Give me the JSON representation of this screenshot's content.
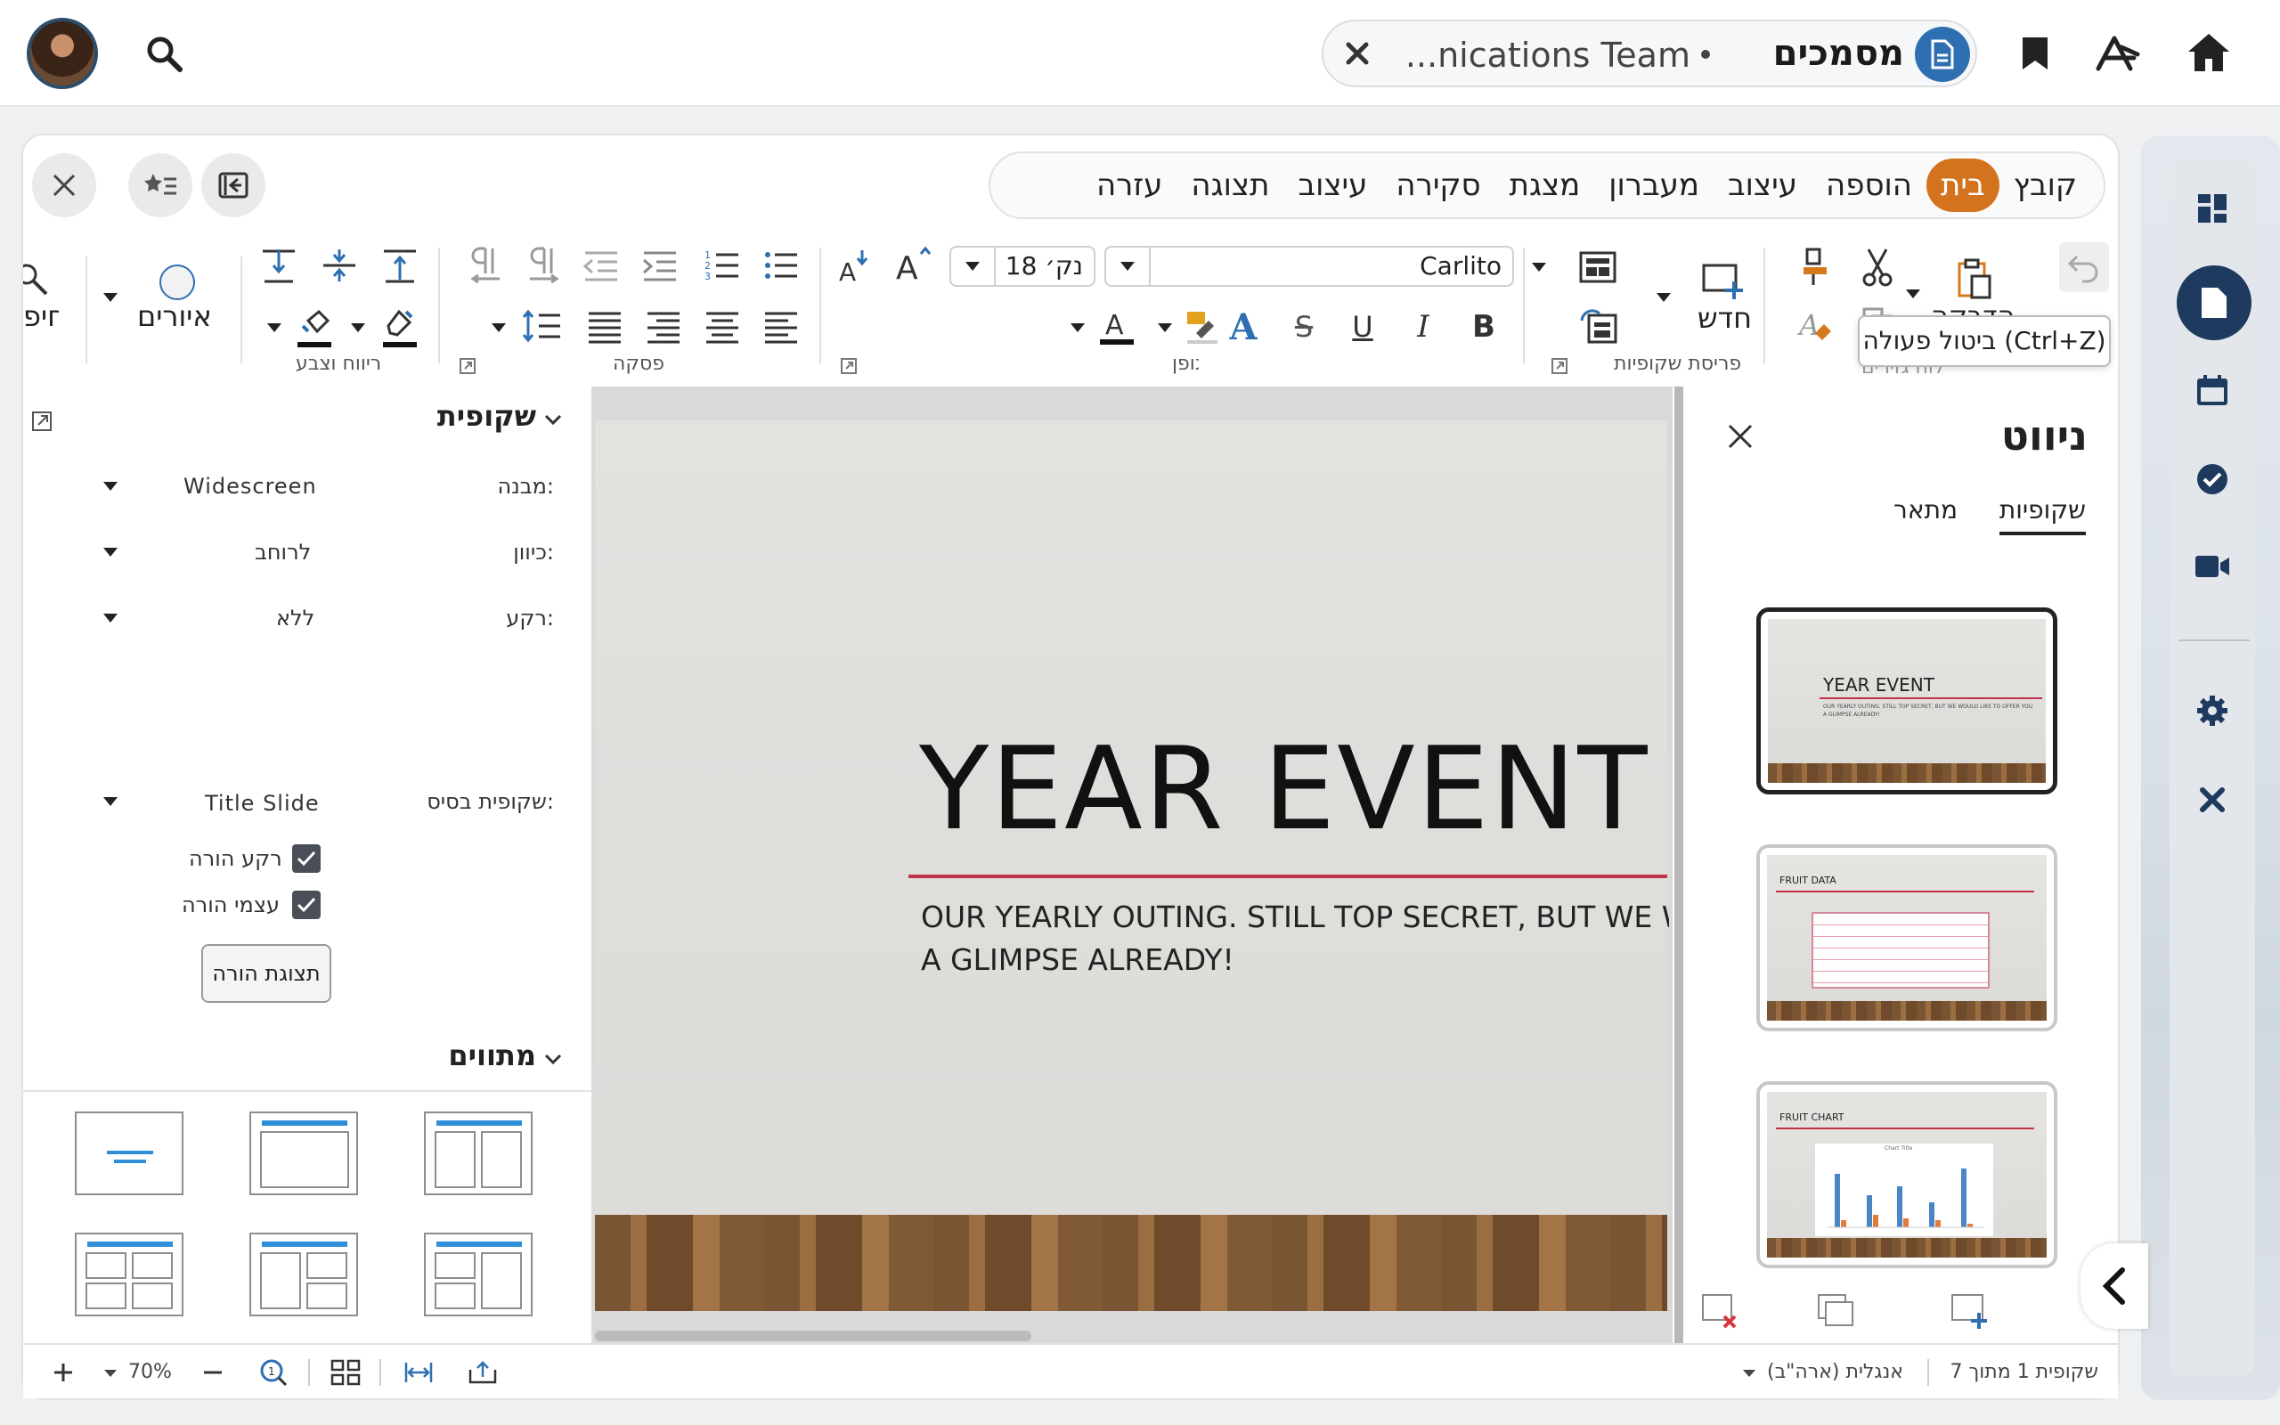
{
  "topbar": {
    "search_chip_label": "מסמכים",
    "search_chip_text": "...nications Team"
  },
  "menu": {
    "items": [
      "קובץ",
      "בית",
      "הוספה",
      "עיצוב",
      "מעברון",
      "מצגת",
      "סקירה",
      "עיצוב",
      "תצוגה",
      "עזרה"
    ],
    "active_index": 1,
    "accent_color": "#d4731d"
  },
  "ribbon": {
    "font_name": "Carlito",
    "font_size": "18 נק׳",
    "new_slide_label": "חדש",
    "clipboard_label": "הדבקה",
    "group_clipboard": "לוח גזירים",
    "group_slides": "פריסת שקופיות",
    "group_font": "גופן",
    "group_paragraph": "פסקה",
    "group_spacing": "ריווח וצבע",
    "shapes_label": "איורים",
    "find_label": "חיפ",
    "tooltip": "ביטול פעולה (Ctrl+Z)"
  },
  "sidebar": {
    "slide_section_title": "שקופית",
    "format_label": "מבנה:",
    "format_value": "Widescreen",
    "orientation_label": "כיוון:",
    "orientation_value": "לרוחב",
    "background_label": "רקע:",
    "background_value": "ללא",
    "master_label": "שקופית בסיס:",
    "master_value": "Title Slide",
    "master_bg_label": "רקע הורה",
    "master_objects_label": "עצמי הורה",
    "master_view_button": "תצוגת הורה",
    "layouts_title": "מתווים"
  },
  "slide": {
    "title": "YEAR EVENT",
    "subtitle_line1": "OUR YEARLY OUTING. STILL TOP SECRET, BUT WE WOU",
    "subtitle_line2": "A GLIMPSE ALREADY!",
    "accent_line_color": "#c0314a"
  },
  "navigator": {
    "title": "ניווט",
    "tab_slides": "שקופיות",
    "tab_outline": "מתאר",
    "thumbnails": [
      {
        "title": "YEAR EVENT",
        "subtitle": "OUR YEARLY OUTING. STILL TOP SECRET, BUT WE WOULD LIKE TO OFFER YOU A GLIMPSE ALREADY!"
      },
      {
        "title": "FRUIT DATA"
      },
      {
        "title": "FRUIT CHART",
        "chart_title": "Chart Title"
      }
    ]
  },
  "status": {
    "slide_position": "שקופית 1 מתוך 7",
    "language": "אנגלית (ארה\"ב)",
    "zoom": "70%"
  }
}
